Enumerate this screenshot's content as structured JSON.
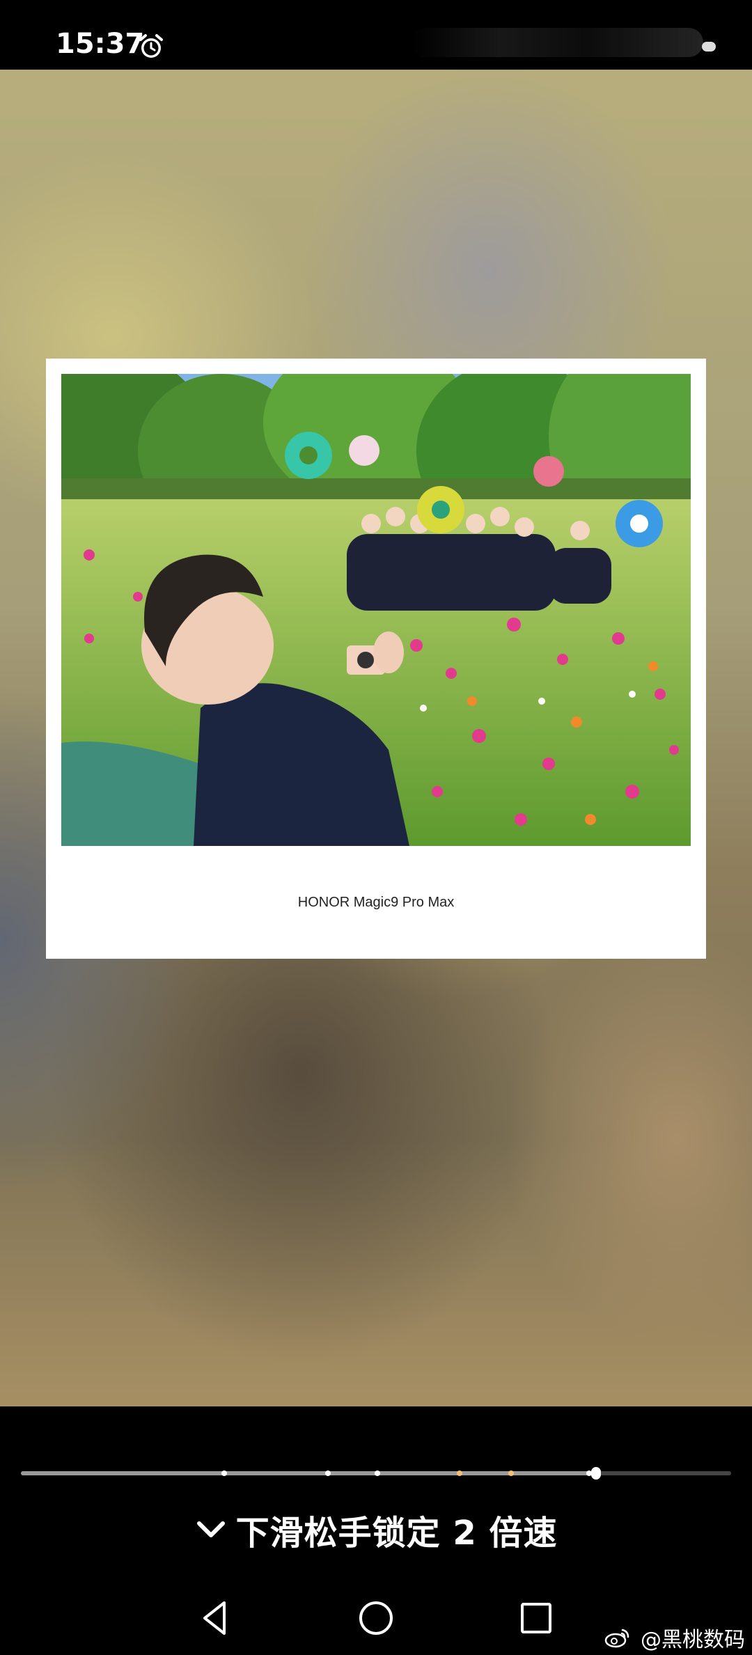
{
  "status_bar": {
    "time": "15:37"
  },
  "photo": {
    "caption": "HONOR Magic9 Pro Max"
  },
  "player": {
    "progress": 0.81,
    "speed_hint": "下滑松手锁定 2 倍速"
  },
  "watermark": {
    "text": "@黑桃数码"
  },
  "icons": [
    "alarm-icon",
    "chevron-down-icon",
    "back-icon",
    "home-icon",
    "recent-apps-icon",
    "weibo-icon"
  ],
  "colors": {
    "background": "#000000",
    "progress_fill": "#9a9a9a",
    "marker_highlight": "#f2c070"
  }
}
